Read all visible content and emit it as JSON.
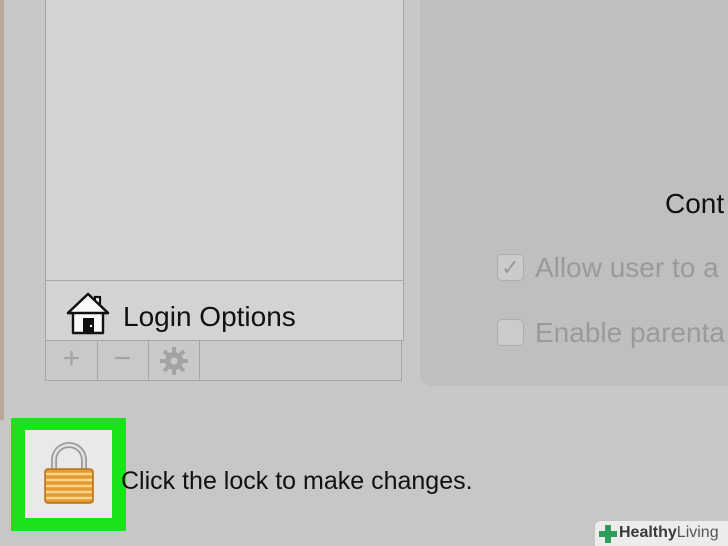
{
  "sidebar": {
    "login_options_label": "Login Options",
    "toolbar": {
      "add_symbol": "+",
      "remove_symbol": "−",
      "gear_icon": "gear-icon"
    }
  },
  "main": {
    "heading": "Cont",
    "checkboxes": [
      {
        "label": "Allow user to a",
        "checked": true
      },
      {
        "label": "Enable parenta",
        "checked": false
      }
    ]
  },
  "lock": {
    "message": "Click the lock to make changes.",
    "icon": "padlock-icon",
    "highlight_color": "#1be21b"
  },
  "watermark": {
    "part1": "Healthy",
    "part2": "Living"
  },
  "colors": {
    "background": "#c7c7c7",
    "panel": "#bfbfbf",
    "list": "#d3d3d3"
  }
}
